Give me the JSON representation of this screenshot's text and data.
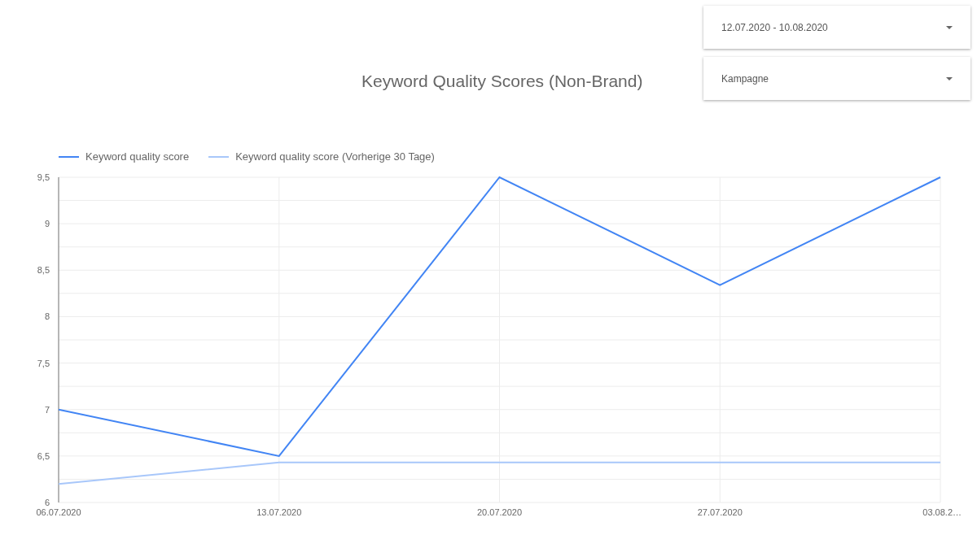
{
  "title": "Keyword Quality Scores (Non-Brand)",
  "filters": [
    {
      "value": "12.07.2020 - 10.08.2020"
    },
    {
      "value": "Kampagne"
    }
  ],
  "chart_data": {
    "type": "line",
    "categories": [
      "06.07.2020",
      "13.07.2020",
      "20.07.2020",
      "27.07.2020",
      "03.08.2…"
    ],
    "series": [
      {
        "name": "Keyword quality score",
        "color": "#4285f4",
        "values": [
          7,
          6.5,
          9.5,
          8.34,
          9.5
        ]
      },
      {
        "name": "Keyword quality score (Vorherige 30 Tage)",
        "color": "#a8c7fa",
        "values": [
          6.2,
          6.43,
          6.43,
          6.43,
          6.43
        ]
      }
    ],
    "ylim": [
      6,
      9.5
    ],
    "grid": true,
    "yticks": [
      {
        "value": 6,
        "label": "6"
      },
      {
        "value": 6.5,
        "label": "6,5"
      },
      {
        "value": 7,
        "label": "7"
      },
      {
        "value": 7.5,
        "label": "7,5"
      },
      {
        "value": 8,
        "label": "8"
      },
      {
        "value": 8.5,
        "label": "8,5"
      },
      {
        "value": 9,
        "label": "9"
      },
      {
        "value": 9.5,
        "label": "9,5"
      }
    ]
  }
}
